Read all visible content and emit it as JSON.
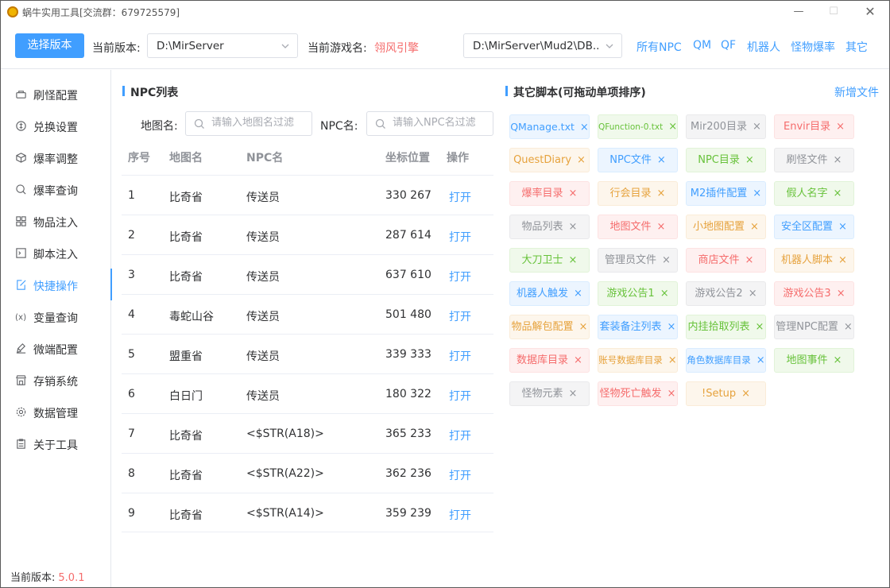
{
  "window": {
    "title": "蜗牛实用工具[交流群：679725579]"
  },
  "toolbar": {
    "select_version_label": "选择版本",
    "current_version_label": "当前版本:",
    "server_path": "D:\\MirServer",
    "game_name_label": "当前游戏名:",
    "game_name": "翎风引擎",
    "db_path": "D:\\MirServer\\Mud2\\DB...",
    "links": [
      "所有NPC",
      "QM",
      "QF",
      "机器人",
      "怪物爆率",
      "其它"
    ]
  },
  "sidebar": {
    "items": [
      {
        "label": "刷怪配置",
        "icon": "monster-refresh-icon"
      },
      {
        "label": "兑换设置",
        "icon": "coin-icon"
      },
      {
        "label": "爆率调整",
        "icon": "cube-icon"
      },
      {
        "label": "爆率查询",
        "icon": "search-icon"
      },
      {
        "label": "物品注入",
        "icon": "grid-icon"
      },
      {
        "label": "脚本注入",
        "icon": "terminal-icon"
      },
      {
        "label": "快捷操作",
        "icon": "edit-icon"
      },
      {
        "label": "变量查询",
        "icon": "variable-icon"
      },
      {
        "label": "微端配置",
        "icon": "brush-icon"
      },
      {
        "label": "存销系统",
        "icon": "shop-icon"
      },
      {
        "label": "数据管理",
        "icon": "settings-icon"
      },
      {
        "label": "关于工具",
        "icon": "document-icon"
      }
    ],
    "active_index": 6,
    "version_label": "当前版本:",
    "version_value": "5.0.1"
  },
  "npc_list": {
    "title": "NPC列表",
    "map_filter_label": "地图名:",
    "map_filter_placeholder": "请输入地图名过滤",
    "npc_filter_label": "NPC名:",
    "npc_filter_placeholder": "请输入NPC名过滤",
    "columns": [
      "序号",
      "地图名",
      "NPC名",
      "坐标位置",
      "操作"
    ],
    "rows": [
      {
        "index": "1",
        "map": "比奇省",
        "npc": "传送员",
        "coords": "330 267",
        "action": "打开"
      },
      {
        "index": "2",
        "map": "比奇省",
        "npc": "传送员",
        "coords": "287 614",
        "action": "打开"
      },
      {
        "index": "3",
        "map": "比奇省",
        "npc": "传送员",
        "coords": "637 610",
        "action": "打开"
      },
      {
        "index": "4",
        "map": "毒蛇山谷",
        "npc": "传送员",
        "coords": "501 480",
        "action": "打开"
      },
      {
        "index": "5",
        "map": "盟重省",
        "npc": "传送员",
        "coords": "339 333",
        "action": "打开"
      },
      {
        "index": "6",
        "map": "白日门",
        "npc": "传送员",
        "coords": "180 322",
        "action": "打开"
      },
      {
        "index": "7",
        "map": "比奇省",
        "npc": "<$STR(A18)>",
        "coords": "365 233",
        "action": "打开"
      },
      {
        "index": "8",
        "map": "比奇省",
        "npc": "<$STR(A22)>",
        "coords": "362 236",
        "action": "打开"
      },
      {
        "index": "9",
        "map": "比奇省",
        "npc": "<$STR(A14)>",
        "coords": "359 239",
        "action": "打开"
      }
    ]
  },
  "other_scripts": {
    "title": "其它脚本(可拖动单项排序)",
    "add_label": "新增文件",
    "close_glyph": "×",
    "tags": [
      {
        "label": "QManage.txt",
        "color": "blue"
      },
      {
        "label": "QFunction-0.txt",
        "color": "green"
      },
      {
        "label": "Mir200目录",
        "color": "gray"
      },
      {
        "label": "Envir目录",
        "color": "red"
      },
      {
        "label": "QuestDiary",
        "color": "orange"
      },
      {
        "label": "NPC文件",
        "color": "blue"
      },
      {
        "label": "NPC目录",
        "color": "green"
      },
      {
        "label": "刷怪文件",
        "color": "gray"
      },
      {
        "label": "爆率目录",
        "color": "red"
      },
      {
        "label": "行会目录",
        "color": "orange"
      },
      {
        "label": "M2插件配置",
        "color": "blue"
      },
      {
        "label": "假人名字",
        "color": "green"
      },
      {
        "label": "物品列表",
        "color": "gray"
      },
      {
        "label": "地图文件",
        "color": "red"
      },
      {
        "label": "小地图配置",
        "color": "orange"
      },
      {
        "label": "安全区配置",
        "color": "blue"
      },
      {
        "label": "大刀卫士",
        "color": "green"
      },
      {
        "label": "管理员文件",
        "color": "gray"
      },
      {
        "label": "商店文件",
        "color": "red"
      },
      {
        "label": "机器人脚本",
        "color": "orange"
      },
      {
        "label": "机器人触发",
        "color": "blue"
      },
      {
        "label": "游戏公告1",
        "color": "green"
      },
      {
        "label": "游戏公告2",
        "color": "gray"
      },
      {
        "label": "游戏公告3",
        "color": "red"
      },
      {
        "label": "物品解包配置",
        "color": "orange"
      },
      {
        "label": "套装备注列表",
        "color": "blue"
      },
      {
        "label": "内挂拾取列表",
        "color": "green"
      },
      {
        "label": "管理NPC配置",
        "color": "gray"
      },
      {
        "label": "数据库目录",
        "color": "red"
      },
      {
        "label": "账号数据库目录",
        "color": "orange"
      },
      {
        "label": "角色数据库目录",
        "color": "blue"
      },
      {
        "label": "地图事件",
        "color": "green"
      },
      {
        "label": "怪物元素",
        "color": "gray"
      },
      {
        "label": "怪物死亡触发",
        "color": "red"
      },
      {
        "label": "!Setup",
        "color": "orange"
      }
    ]
  },
  "colors": {
    "accent": "#409eff",
    "danger": "#f56c6c"
  }
}
